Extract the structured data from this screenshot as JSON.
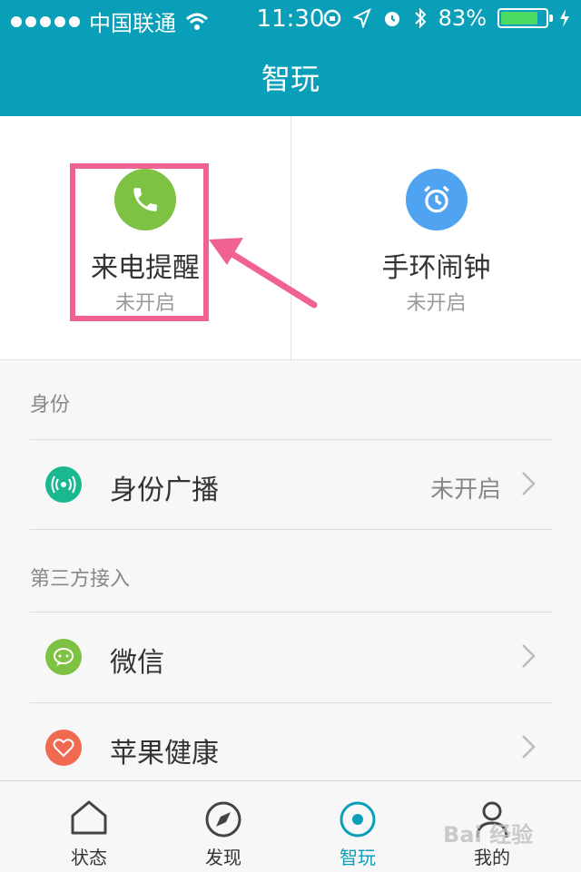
{
  "status_bar": {
    "carrier": "中国联通",
    "time": "11:30",
    "battery": "83%",
    "battery_level": 0.83
  },
  "header": {
    "title": "智玩"
  },
  "features": [
    {
      "title": "来电提醒",
      "status": "未开启",
      "icon": "phone-icon",
      "color": "#7dc243"
    },
    {
      "title": "手环闹钟",
      "status": "未开启",
      "icon": "alarm-clock-icon",
      "color": "#4fa3f0"
    }
  ],
  "sections": [
    {
      "label": "身份",
      "items": [
        {
          "label": "身份广播",
          "value": "未开启",
          "icon": "broadcast-icon",
          "color": "#19b88f"
        }
      ]
    },
    {
      "label": "第三方接入",
      "items": [
        {
          "label": "微信",
          "value": "",
          "icon": "wechat-icon",
          "color": "#7dc243"
        },
        {
          "label": "苹果健康",
          "value": "",
          "icon": "heart-icon",
          "color": "#f06a52"
        }
      ]
    }
  ],
  "tabs": [
    {
      "label": "状态",
      "icon": "home-icon"
    },
    {
      "label": "发现",
      "icon": "compass-icon"
    },
    {
      "label": "智玩",
      "icon": "target-icon",
      "active": true
    },
    {
      "label": "我的",
      "icon": "person-icon"
    }
  ],
  "watermark": "Bai 经验",
  "colors": {
    "accent": "#0a9fb8",
    "highlight": "#f06292"
  }
}
